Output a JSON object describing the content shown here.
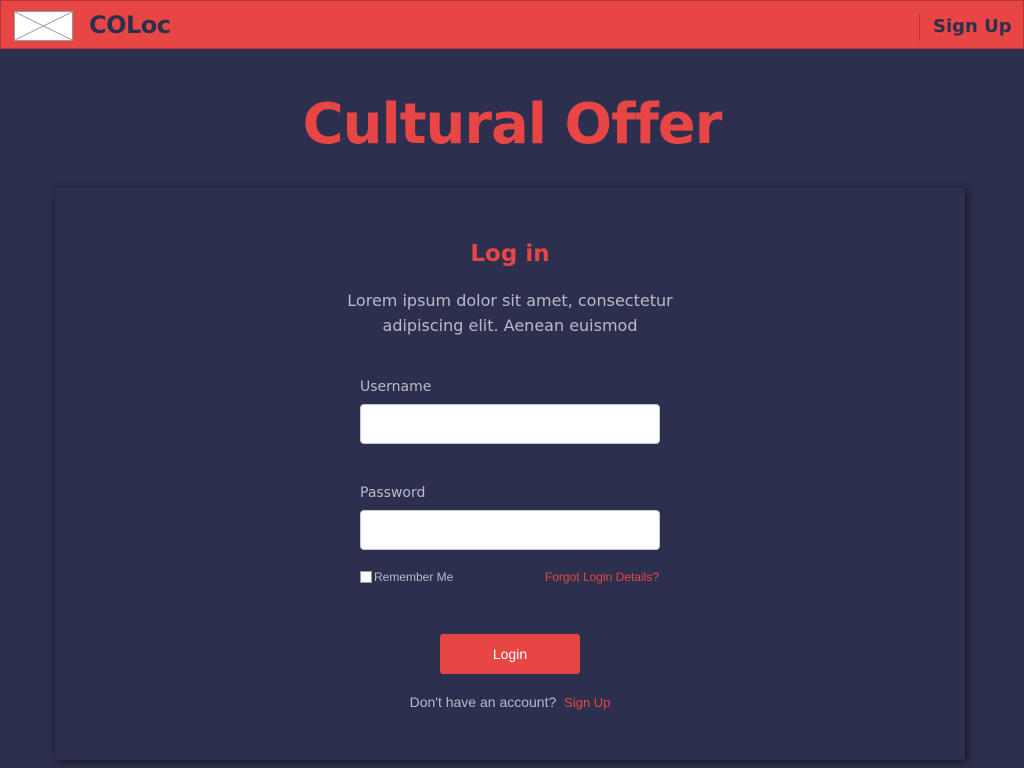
{
  "navbar": {
    "logo_icon": "image-placeholder-icon",
    "brand": "COLoc",
    "signup_label": "Sign Up",
    "background_color": "#e84545"
  },
  "hero": {
    "title": "Cultural Offer"
  },
  "login_card": {
    "title": "Log in",
    "description": "Lorem ipsum dolor sit amet, consectetur adipiscing elit. Aenean euismod",
    "username": {
      "label": "Username",
      "value": "",
      "placeholder": ""
    },
    "password": {
      "label": "Password",
      "value": "",
      "placeholder": ""
    },
    "remember_me": {
      "label": "Remember Me",
      "checked": false
    },
    "forgot_link": "Forgot Login Details?",
    "login_button": "Login",
    "signup_prompt": "Don't have an account?",
    "signup_link": "Sign Up"
  },
  "colors": {
    "accent": "#e84545",
    "background": "#2d2f4e",
    "muted_text": "#b9b9c8"
  }
}
